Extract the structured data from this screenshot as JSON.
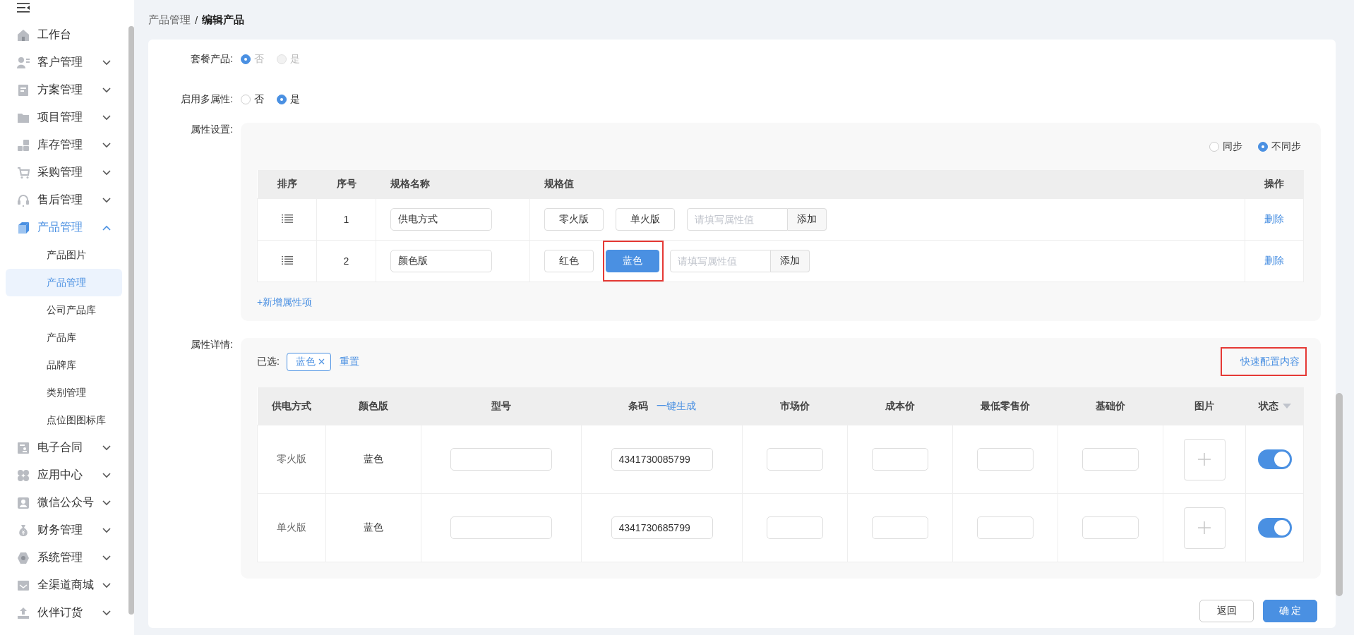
{
  "sidebar": {
    "items": [
      {
        "label": "工作台"
      },
      {
        "label": "客户管理",
        "expanded": false
      },
      {
        "label": "方案管理",
        "expanded": false
      },
      {
        "label": "项目管理",
        "expanded": false
      },
      {
        "label": "库存管理",
        "expanded": false
      },
      {
        "label": "采购管理",
        "expanded": false
      },
      {
        "label": "售后管理",
        "expanded": false
      },
      {
        "label": "产品管理",
        "expanded": true,
        "children": [
          {
            "label": "产品图片",
            "selected": false
          },
          {
            "label": "产品管理",
            "selected": true
          },
          {
            "label": "公司产品库",
            "selected": false
          },
          {
            "label": "产品库",
            "selected": false
          },
          {
            "label": "品牌库",
            "selected": false
          },
          {
            "label": "类别管理",
            "selected": false
          },
          {
            "label": "点位图图标库",
            "selected": false
          }
        ]
      },
      {
        "label": "电子合同",
        "expanded": false
      },
      {
        "label": "应用中心",
        "expanded": false
      },
      {
        "label": "微信公众号",
        "expanded": false
      },
      {
        "label": "财务管理",
        "expanded": false
      },
      {
        "label": "系统管理",
        "expanded": false
      },
      {
        "label": "全渠道商城",
        "expanded": false
      },
      {
        "label": "伙伴订货",
        "expanded": false
      }
    ]
  },
  "breadcrumb": {
    "separator": "/",
    "items": [
      {
        "label": "产品管理",
        "current": false
      },
      {
        "label": "编辑产品",
        "current": true
      }
    ]
  },
  "bundle": {
    "label": "套餐产品:",
    "options": [
      {
        "label": "否",
        "selected": true,
        "disabled": true
      },
      {
        "label": "是",
        "selected": false,
        "disabled": true
      }
    ]
  },
  "multi_attr": {
    "label": "启用多属性:",
    "options": [
      {
        "label": "否",
        "selected": false,
        "disabled": false
      },
      {
        "label": "是",
        "selected": true,
        "disabled": false
      }
    ]
  },
  "attr_settings": {
    "label": "属性设置:",
    "sync_options": [
      {
        "label": "同步",
        "selected": false
      },
      {
        "label": "不同步",
        "selected": true
      }
    ],
    "columns": [
      "排序",
      "序号",
      "规格名称",
      "规格值",
      "操作"
    ],
    "rows": [
      {
        "index": "1",
        "name": "供电方式",
        "values": [
          {
            "label": "零火版",
            "selected": false,
            "highlighted": false
          },
          {
            "label": "单火版",
            "selected": false,
            "highlighted": false
          }
        ],
        "placeholder": "请填写属性值",
        "add": "添加",
        "action": "删除"
      },
      {
        "index": "2",
        "name": "颜色版",
        "values": [
          {
            "label": "红色",
            "selected": false,
            "highlighted": false
          },
          {
            "label": "蓝色",
            "selected": true,
            "highlighted": true
          }
        ],
        "placeholder": "请填写属性值",
        "add": "添加",
        "action": "删除"
      }
    ],
    "add_link": "+新增属性项"
  },
  "attr_detail": {
    "label": "属性详情:",
    "selected_label": "已选:",
    "selected_tags": [
      "蓝色"
    ],
    "reset": "重置",
    "quick_config": {
      "label": "快速配置内容",
      "highlighted": true
    },
    "columns": [
      {
        "label": "供电方式",
        "dropdown": false
      },
      {
        "label": "颜色版",
        "dropdown": false
      },
      {
        "label": "型号",
        "dropdown": false
      },
      {
        "label": "条码",
        "action": "一键生成",
        "dropdown": false
      },
      {
        "label": "市场价",
        "dropdown": false
      },
      {
        "label": "成本价",
        "dropdown": false
      },
      {
        "label": "最低零售价",
        "dropdown": false
      },
      {
        "label": "基础价",
        "dropdown": false
      },
      {
        "label": "图片",
        "dropdown": false
      },
      {
        "label": "状态",
        "dropdown": true
      }
    ],
    "rows": [
      {
        "power": "零火版",
        "color_version": "蓝色",
        "barcode": "4341730085799",
        "on": true
      },
      {
        "power": "单火版",
        "color_version": "蓝色",
        "barcode": "4341730685799",
        "on": true
      }
    ]
  },
  "buttons": [
    {
      "label": "返回",
      "kind": "default"
    },
    {
      "label": "确 定",
      "kind": "primary"
    }
  ]
}
